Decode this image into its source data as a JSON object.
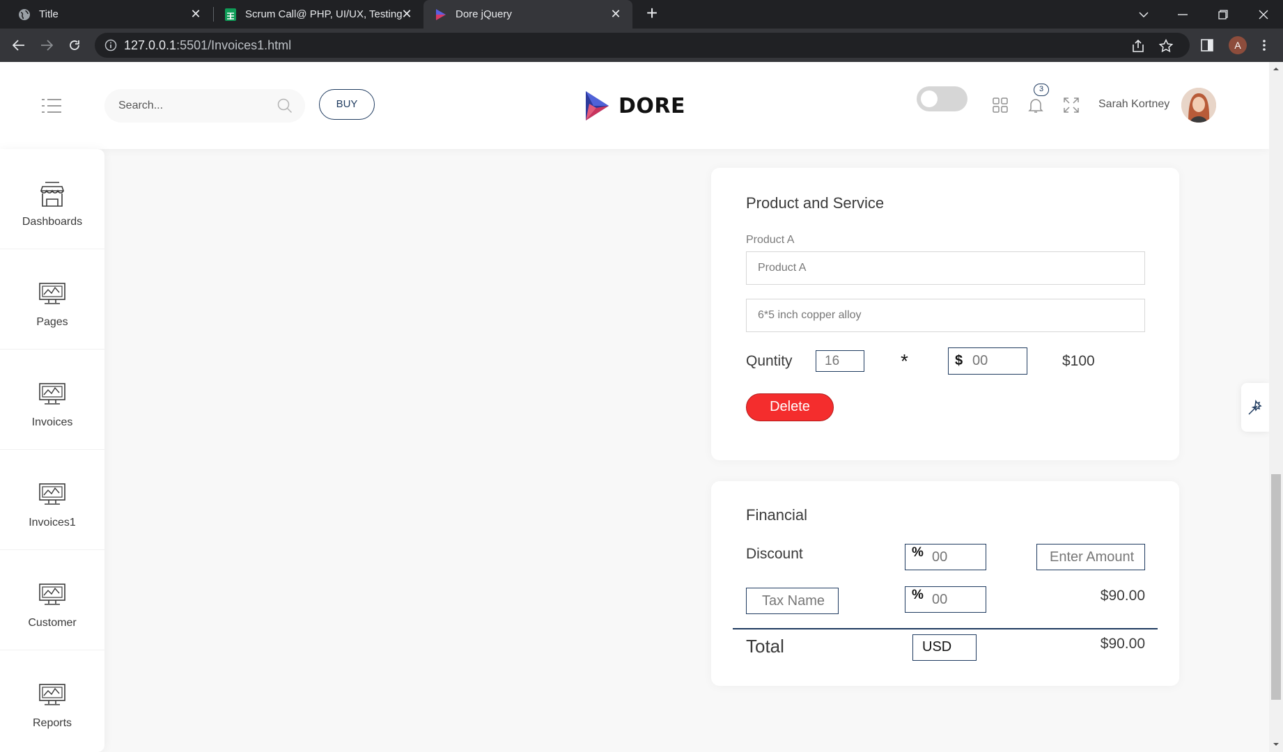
{
  "browser": {
    "tabs": [
      {
        "title": "Title",
        "icon": "globe-icon"
      },
      {
        "title": "Scrum Call@ PHP, UI/UX, Testing",
        "icon": "sheets-icon"
      },
      {
        "title": "Dore jQuery",
        "icon": "dore-icon"
      }
    ],
    "url_host": "127.0.0.1",
    "url_rest": ":5501/Invoices1.html",
    "profile_initial": "A"
  },
  "header": {
    "search_placeholder": "Search...",
    "buy_label": "BUY",
    "logo_text": "DORE",
    "notification_count": "3",
    "user_name": "Sarah Kortney"
  },
  "sidebar": {
    "items": [
      {
        "label": "Dashboards",
        "icon": "shop-icon"
      },
      {
        "label": "Pages",
        "icon": "monitor-icon"
      },
      {
        "label": "Invoices",
        "icon": "monitor-icon"
      },
      {
        "label": "Invoices1",
        "icon": "monitor-icon"
      },
      {
        "label": "Customer",
        "icon": "monitor-icon"
      },
      {
        "label": "Reports",
        "icon": "monitor-icon"
      }
    ]
  },
  "product_card": {
    "title": "Product and Service",
    "product_label": "Product A",
    "product_placeholder": "Product A",
    "description_placeholder": "6*5 inch copper alloy",
    "quantity_label": "Quntity",
    "quantity_placeholder": "16",
    "multiply": "*",
    "currency_symbol": "$",
    "price_placeholder": "00",
    "line_total": "$100",
    "delete_label": "Delete"
  },
  "financial_card": {
    "title": "Financial",
    "discount_label": "Discount",
    "percent_symbol": "%",
    "discount_placeholder": "00",
    "amount_placeholder": "Enter Amount",
    "tax_name_placeholder": "Tax Name",
    "tax_placeholder": "00",
    "tax_amount": "$90.00",
    "total_label": "Total",
    "currency": "USD",
    "total_amount": "$90.00"
  },
  "colors": {
    "accent": "#1e3a5f",
    "delete": "#f42d2d",
    "background": "#f8f8f8"
  }
}
